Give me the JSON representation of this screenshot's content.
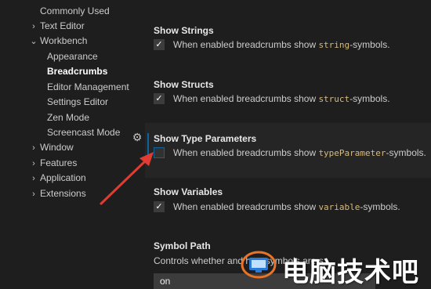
{
  "sidebar": {
    "items": [
      {
        "label": "Commonly Used"
      },
      {
        "label": "Text Editor"
      },
      {
        "label": "Workbench"
      },
      {
        "label": "Appearance"
      },
      {
        "label": "Breadcrumbs"
      },
      {
        "label": "Editor Management"
      },
      {
        "label": "Settings Editor"
      },
      {
        "label": "Zen Mode"
      },
      {
        "label": "Screencast Mode"
      },
      {
        "label": "Window"
      },
      {
        "label": "Features"
      },
      {
        "label": "Application"
      },
      {
        "label": "Extensions"
      }
    ]
  },
  "settings": [
    {
      "title": "Show Strings",
      "desc_pre": "When enabled breadcrumbs show ",
      "code": "string",
      "desc_post": "-symbols.",
      "checked": true
    },
    {
      "title": "Show Structs",
      "desc_pre": "When enabled breadcrumbs show ",
      "code": "struct",
      "desc_post": "-symbols.",
      "checked": true
    },
    {
      "title": "Show Type Parameters",
      "desc_pre": "When enabled breadcrumbs show ",
      "code": "typeParameter",
      "desc_post": "-symbols.",
      "checked": false
    },
    {
      "title": "Show Variables",
      "desc_pre": "When enabled breadcrumbs show ",
      "code": "variable",
      "desc_post": "-symbols.",
      "checked": true
    }
  ],
  "symbol_path": {
    "title": "Symbol Path",
    "desc": "Controls whether and how symbols are s",
    "value": "on"
  },
  "icons": {
    "chevron_right": "chevron-right-icon",
    "chevron_down": "chevron-down-icon",
    "gear": "gear-icon",
    "check": "check-icon"
  },
  "watermark": {
    "text": "电脑技术吧"
  },
  "colors": {
    "accent": "#0e639c",
    "code": "#d7ba7d",
    "annotation_arrow": "#e03c31"
  }
}
